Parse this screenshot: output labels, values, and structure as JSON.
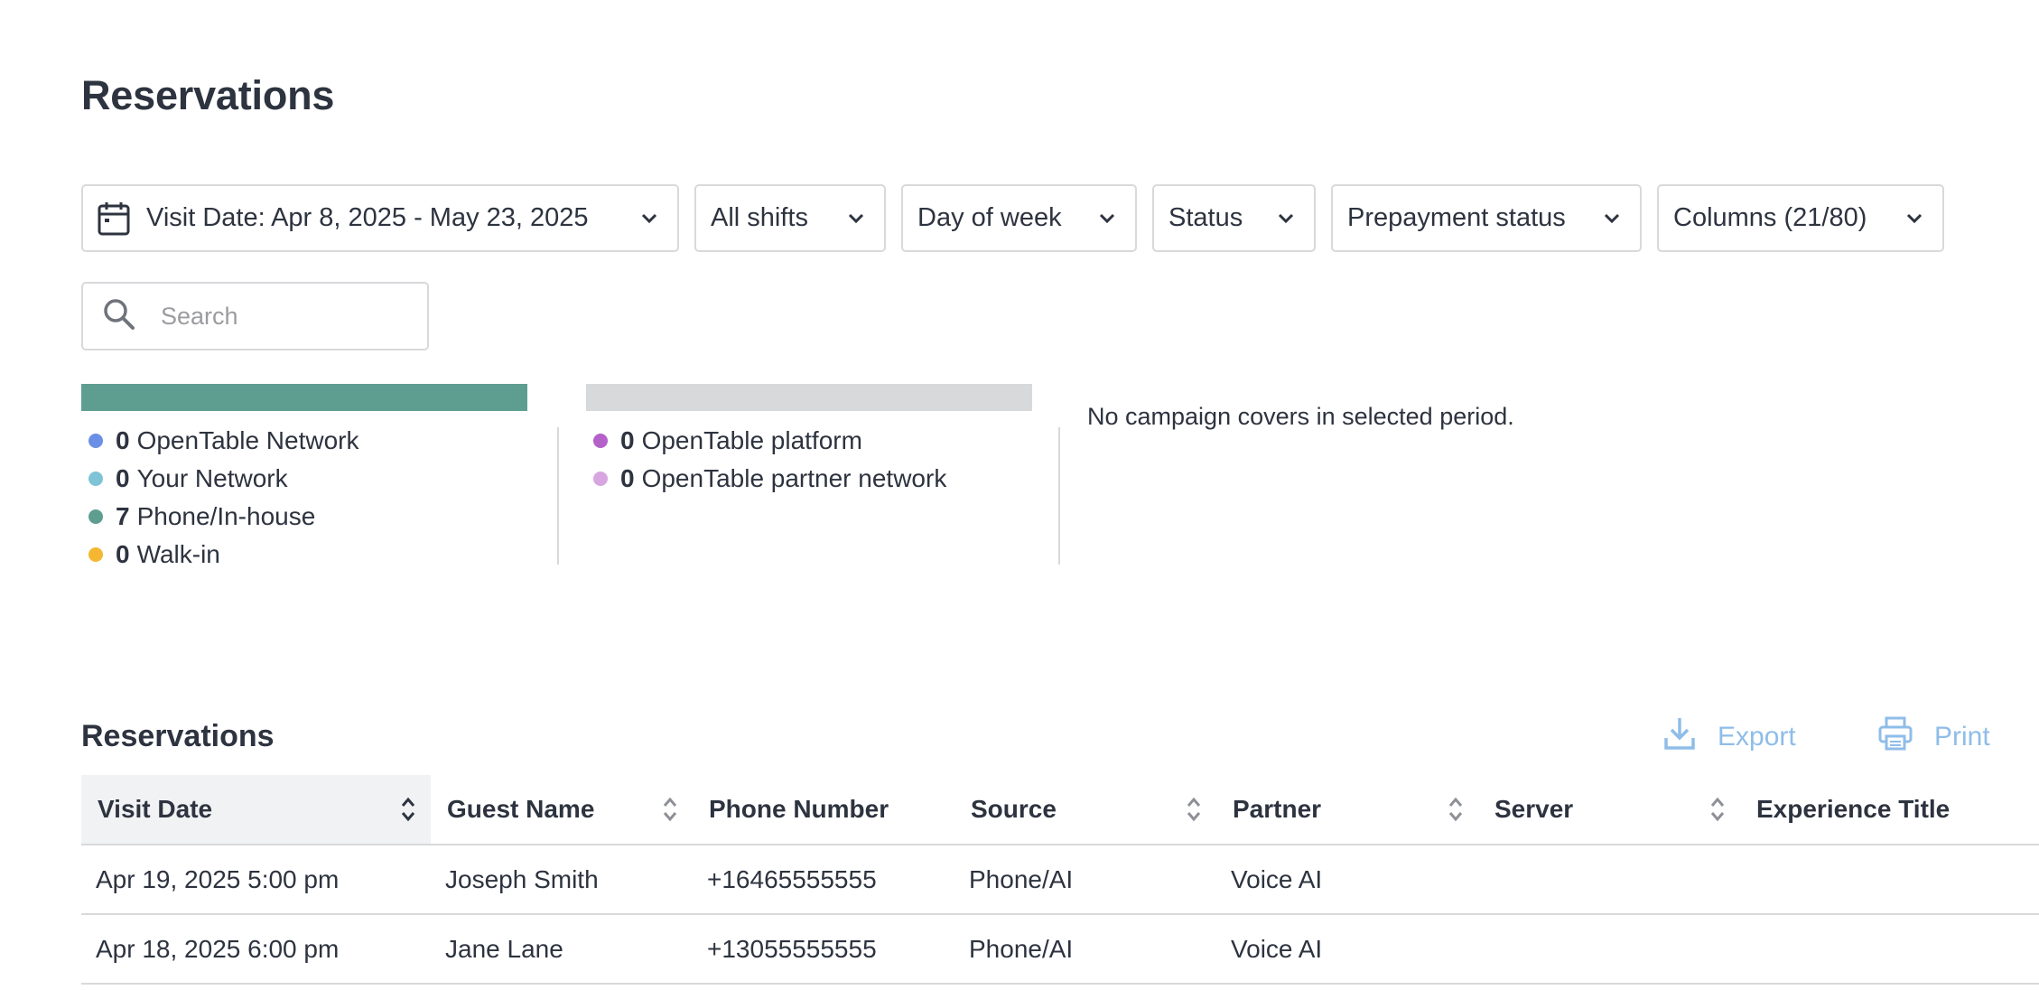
{
  "page": {
    "title": "Reservations"
  },
  "filters": {
    "visit_date": "Visit Date: Apr 8, 2025 - May 23, 2025",
    "shifts": "All shifts",
    "day_of_week": "Day of week",
    "status": "Status",
    "prepayment": "Prepayment status",
    "columns": "Columns (21/80)"
  },
  "search": {
    "placeholder": "Search",
    "value": ""
  },
  "stats": {
    "group1": {
      "bar_color": "#5e9e91",
      "items": [
        {
          "count": "0",
          "label": "OpenTable Network",
          "color": "#6b8fe6"
        },
        {
          "count": "0",
          "label": "Your Network",
          "color": "#7fc3d6"
        },
        {
          "count": "7",
          "label": "Phone/In-house",
          "color": "#5e9e91"
        },
        {
          "count": "0",
          "label": "Walk-in",
          "color": "#f5b731"
        }
      ]
    },
    "group2": {
      "bar_color": "#d8d9db",
      "items": [
        {
          "count": "0",
          "label": "OpenTable platform",
          "color": "#b461c9"
        },
        {
          "count": "0",
          "label": "OpenTable partner network",
          "color": "#d7a6e0"
        }
      ]
    },
    "campaign_note": "No campaign covers in selected period."
  },
  "section": {
    "title": "Reservations",
    "export_label": "Export",
    "print_label": "Print",
    "action_color": "#8fbde8"
  },
  "table": {
    "columns": [
      "Visit Date",
      "Guest Name",
      "Phone Number",
      "Source",
      "Partner",
      "Server",
      "Experience Title"
    ],
    "rows": [
      [
        "Apr 19, 2025 5:00 pm",
        "Joseph Smith",
        "+16465555555",
        "Phone/AI",
        "Voice AI",
        "",
        ""
      ],
      [
        "Apr 18, 2025 6:00 pm",
        "Jane Lane",
        "+13055555555",
        "Phone/AI",
        "Voice AI",
        "",
        ""
      ]
    ]
  },
  "icons": [
    "calendar-icon",
    "chevron-down-icon",
    "search-icon",
    "export-icon",
    "print-icon",
    "sort-icon"
  ]
}
